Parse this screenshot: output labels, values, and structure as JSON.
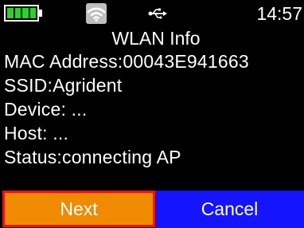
{
  "status_bar": {
    "time": "14:57",
    "battery_icon": "battery-full-icon",
    "wifi_icon": "wifi-icon",
    "usb_icon": "usb-icon",
    "battery_color": "#2ad22a"
  },
  "title": "WLAN Info",
  "info": {
    "mac": "MAC Address:00043E941663",
    "ssid": "SSID:Agrident",
    "device": "Device: ...",
    "host": "Host: ...",
    "status": "Status:connecting AP"
  },
  "buttons": {
    "next_label": "Next",
    "cancel_label": "Cancel",
    "next_color": "#f08a00",
    "cancel_color": "#1414ff"
  }
}
